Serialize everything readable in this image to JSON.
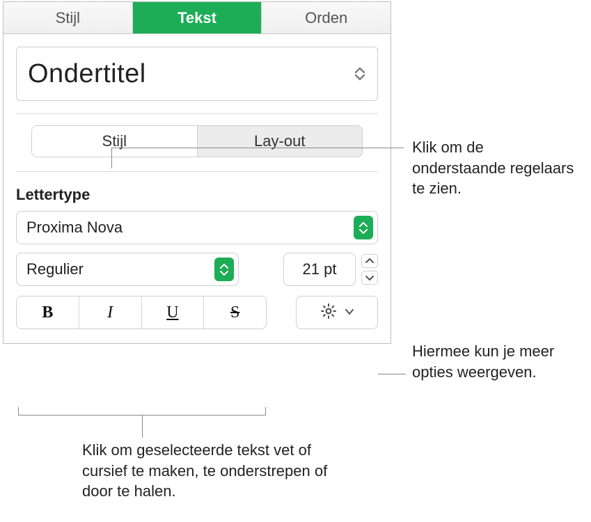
{
  "tabs": {
    "style": "Stijl",
    "text": "Tekst",
    "order": "Orden"
  },
  "paragraph_style": "Ondertitel",
  "segmented": {
    "style": "Stijl",
    "layout": "Lay-out"
  },
  "font_section_label": "Lettertype",
  "font_family": "Proxima Nova",
  "font_weight": "Regulier",
  "font_size": "21 pt",
  "style_buttons": {
    "bold": "B",
    "italic": "I",
    "underline": "U",
    "strike": "S"
  },
  "callouts": {
    "segmented": "Klik om de onderstaande regelaars te zien.",
    "gear": "Hiermee kun je meer opties weergeven.",
    "styles": "Klik om geselecteerde tekst vet of cursief te maken, te onderstrepen of door te halen."
  }
}
